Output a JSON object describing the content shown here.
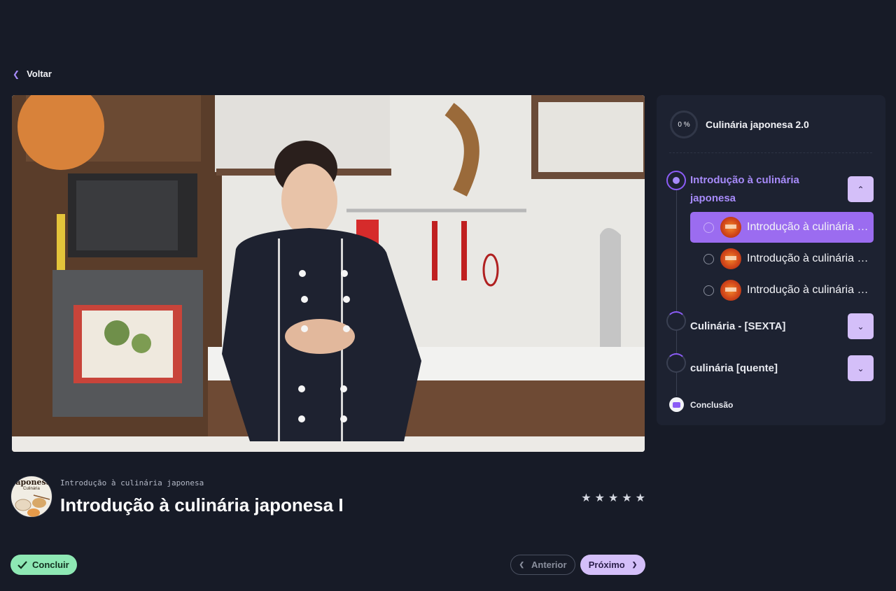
{
  "nav": {
    "back_label": "Voltar"
  },
  "lesson": {
    "module_subtitle": "Introdução à culinária japonesa",
    "title": "Introdução à culinária japonesa I",
    "rating_stars": 5,
    "course_thumb_text": "Japonesa",
    "course_thumb_subtext": "Culinária"
  },
  "actions": {
    "complete_label": "Concluir",
    "previous_label": "Anterior",
    "next_label": "Próximo"
  },
  "sidebar": {
    "progress_label": "0 %",
    "progress_value": 0,
    "course_title": "Culinária japonesa 2.0",
    "modules": [
      {
        "title": "Introdução à culinária japonesa",
        "expanded": true,
        "lessons": [
          {
            "title": "Introdução à culinária japonesa I",
            "current": true
          },
          {
            "title": "Introdução à culinária japonesa II",
            "current": false
          },
          {
            "title": "Introdução à culinária japonesa III",
            "current": false
          }
        ]
      },
      {
        "title": "Culinária - [SEXTA]",
        "expanded": false
      },
      {
        "title": "culinária [quente]",
        "expanded": false
      }
    ],
    "conclusion_label": "Conclusão"
  },
  "colors": {
    "background": "#171b27",
    "panel": "#1d2231",
    "accent": "#9b6cf0",
    "accent_light": "#d4bff9",
    "success": "#8ee8b4"
  }
}
